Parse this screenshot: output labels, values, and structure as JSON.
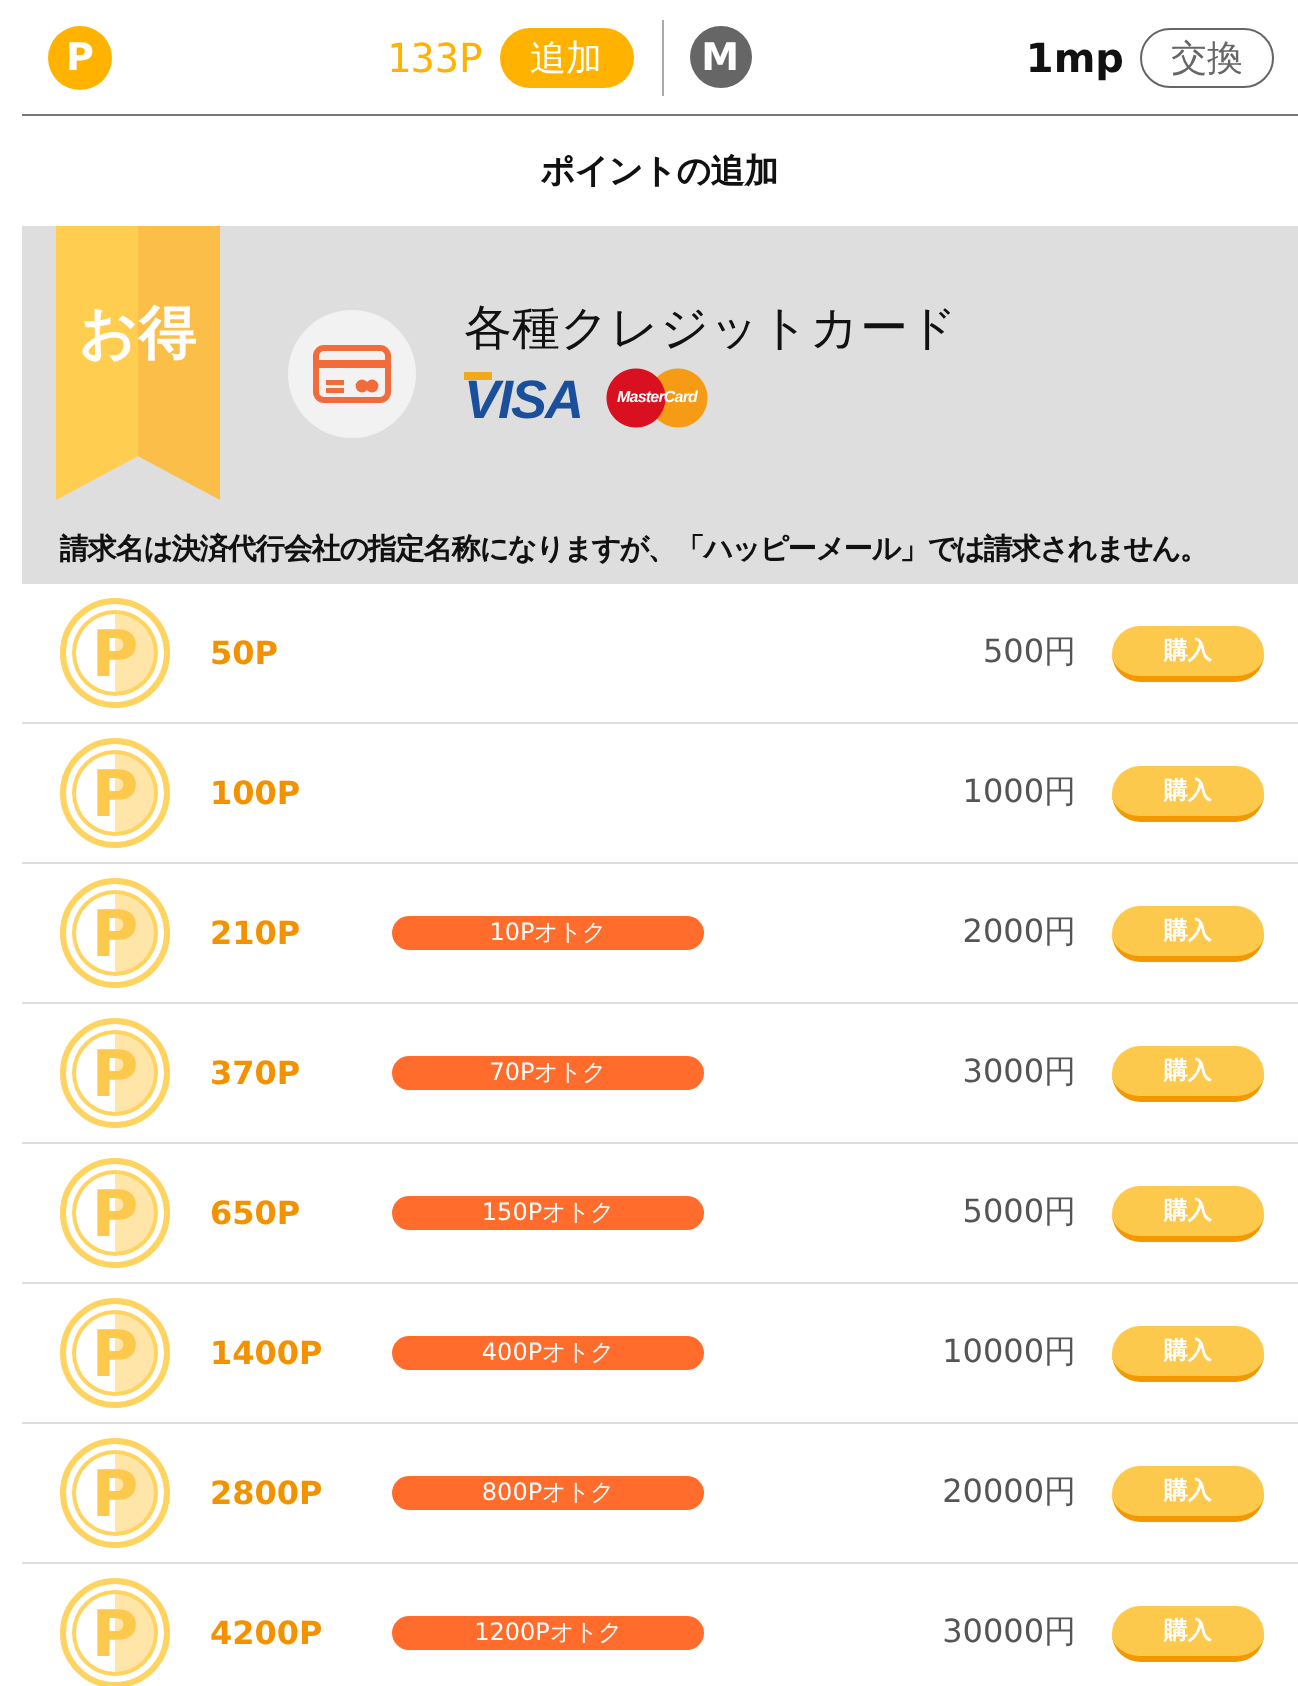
{
  "header": {
    "point_badge": "P",
    "points": "133P",
    "add_button": "追加",
    "mileage_badge": "M",
    "mileage": "1mp",
    "exchange_button": "交換"
  },
  "title": "ポイントの追加",
  "banner": {
    "ribbon": "お得",
    "method": "各種クレジットカード",
    "brands": [
      {
        "kind": "visa",
        "label": "VISA"
      },
      {
        "kind": "mastercard",
        "label": "MasterCard"
      }
    ],
    "notice": "請求名は決済代行会社の指定名称になりますが、「ハッピーメール」では請求されません。"
  },
  "plans": [
    {
      "coin": "P",
      "points": "50P",
      "price": "500円",
      "button": "購入"
    },
    {
      "coin": "P",
      "points": "100P",
      "price": "1000円",
      "button": "購入"
    },
    {
      "coin": "P",
      "points": "210P",
      "bonus": "10Pオトク",
      "price": "2000円",
      "button": "購入"
    },
    {
      "coin": "P",
      "points": "370P",
      "bonus": "70Pオトク",
      "price": "3000円",
      "button": "購入"
    },
    {
      "coin": "P",
      "points": "650P",
      "bonus": "150Pオトク",
      "price": "5000円",
      "button": "購入"
    },
    {
      "coin": "P",
      "points": "1400P",
      "bonus": "400Pオトク",
      "price": "10000円",
      "button": "購入"
    },
    {
      "coin": "P",
      "points": "2800P",
      "bonus": "800Pオトク",
      "price": "20000円",
      "button": "購入"
    },
    {
      "coin": "P",
      "points": "4200P",
      "bonus": "1200Pオトク",
      "price": "30000円",
      "button": "購入"
    }
  ]
}
